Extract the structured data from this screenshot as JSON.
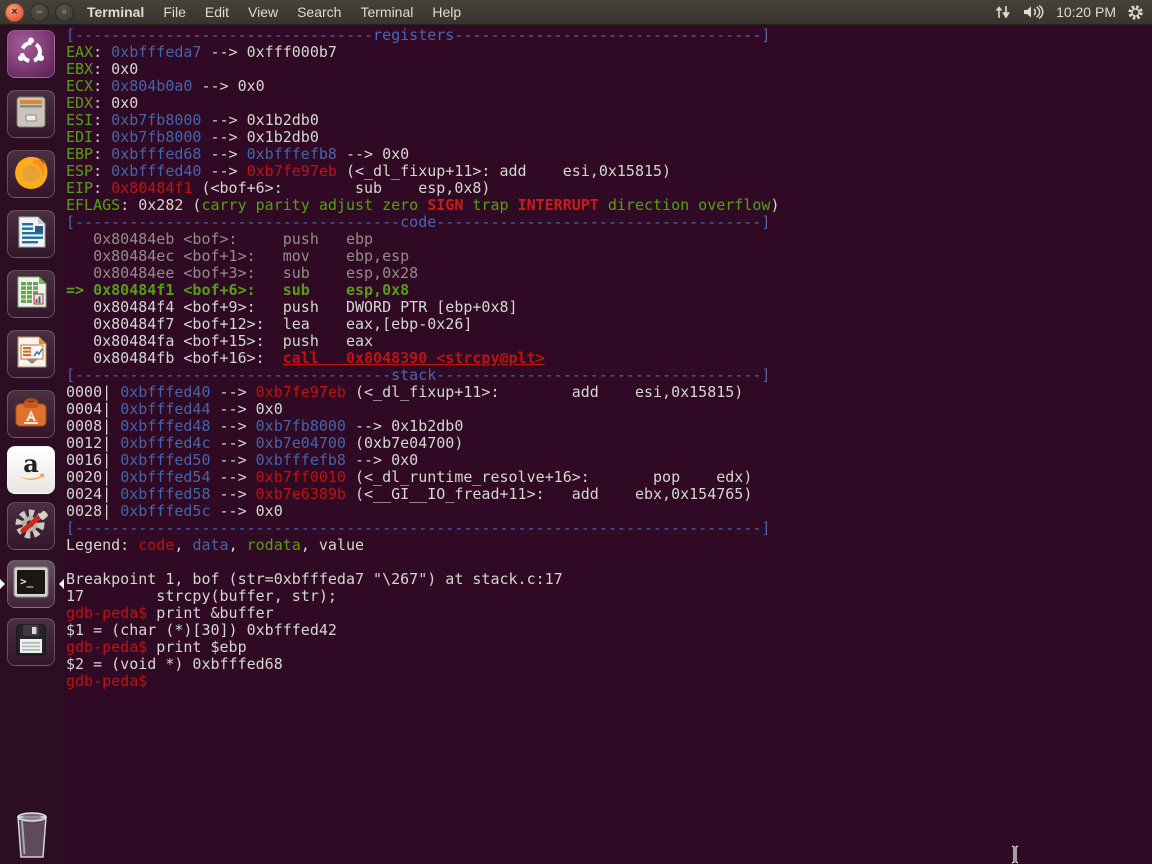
{
  "panel": {
    "window_buttons": {
      "close": "×",
      "minimize": "–",
      "maximize": "▫"
    },
    "app_title": "Terminal",
    "menus": [
      "File",
      "Edit",
      "View",
      "Search",
      "Terminal",
      "Help"
    ],
    "clock": "10:20 PM",
    "indicator_icons": [
      "network-arrows-icon",
      "volume-icon",
      "session-gear-icon"
    ]
  },
  "launcher": {
    "items": [
      {
        "name": "Ubuntu Dash"
      },
      {
        "name": "Files"
      },
      {
        "name": "Firefox Web Browser"
      },
      {
        "name": "LibreOffice Writer"
      },
      {
        "name": "LibreOffice Calc"
      },
      {
        "name": "LibreOffice Impress"
      },
      {
        "name": "Ubuntu Software Center"
      },
      {
        "name": "Amazon"
      },
      {
        "name": "System Settings"
      },
      {
        "name": "Terminal"
      },
      {
        "name": "Disk"
      },
      {
        "name": "Trash"
      }
    ],
    "active_item": "Terminal"
  },
  "terminal": {
    "colors": {
      "background": "#300A24",
      "foreground": "#d3d7cf",
      "data_blue": "#4665a9",
      "code_red": "#c01010",
      "rodata_green": "#55a012",
      "dim_gray": "#928e87"
    },
    "lines": [
      [
        [
          "ban",
          "[---------------------------------registers----------------------------------]"
        ]
      ],
      [
        [
          "g",
          "EAX"
        ],
        [
          "w",
          ": "
        ],
        [
          "b",
          "0xbfffeda7"
        ],
        [
          "w",
          " --> 0xfff000b7"
        ]
      ],
      [
        [
          "g",
          "EBX"
        ],
        [
          "w",
          ": 0x0"
        ]
      ],
      [
        [
          "g",
          "ECX"
        ],
        [
          "w",
          ": "
        ],
        [
          "b",
          "0x804b0a0"
        ],
        [
          "w",
          " --> 0x0"
        ]
      ],
      [
        [
          "g",
          "EDX"
        ],
        [
          "w",
          ": 0x0"
        ]
      ],
      [
        [
          "g",
          "ESI"
        ],
        [
          "w",
          ": "
        ],
        [
          "b",
          "0xb7fb8000"
        ],
        [
          "w",
          " --> 0x1b2db0"
        ]
      ],
      [
        [
          "g",
          "EDI"
        ],
        [
          "w",
          ": "
        ],
        [
          "b",
          "0xb7fb8000"
        ],
        [
          "w",
          " --> 0x1b2db0"
        ]
      ],
      [
        [
          "g",
          "EBP"
        ],
        [
          "w",
          ": "
        ],
        [
          "b",
          "0xbfffed68"
        ],
        [
          "w",
          " --> "
        ],
        [
          "b",
          "0xbfffefb8"
        ],
        [
          "w",
          " --> 0x0"
        ]
      ],
      [
        [
          "g",
          "ESP"
        ],
        [
          "w",
          ": "
        ],
        [
          "b",
          "0xbfffed40"
        ],
        [
          "w",
          " --> "
        ],
        [
          "r",
          "0xb7fe97eb"
        ],
        [
          "w",
          " (<_dl_fixup+11>: add    esi,0x15815)"
        ]
      ],
      [
        [
          "g",
          "EIP"
        ],
        [
          "w",
          ": "
        ],
        [
          "r",
          "0x80484f1"
        ],
        [
          "w",
          " (<bof+6>:        sub    esp,0x8)"
        ]
      ],
      [
        [
          "g",
          "EFLAGS"
        ],
        [
          "w",
          ": 0x282 ("
        ],
        [
          "g",
          "carry parity adjust zero "
        ],
        [
          "rb",
          "SIGN"
        ],
        [
          "g",
          " trap "
        ],
        [
          "rb",
          "INTERRUPT"
        ],
        [
          "g",
          " direction overflow"
        ],
        [
          "w",
          ")"
        ]
      ],
      [
        [
          "ban",
          "[------------------------------------code------------------------------------]"
        ]
      ],
      [
        [
          "gray",
          "   0x80484eb <bof>:     push   ebp"
        ]
      ],
      [
        [
          "gray",
          "   0x80484ec <bof+1>:   mov    ebp,esp"
        ]
      ],
      [
        [
          "gray",
          "   0x80484ee <bof+3>:   sub    esp,0x28"
        ]
      ],
      [
        [
          "gb",
          "=> 0x80484f1 <bof+6>:   sub    esp,0x8"
        ]
      ],
      [
        [
          "w",
          "   0x80484f4 <bof+9>:   push   DWORD PTR [ebp+0x8]"
        ]
      ],
      [
        [
          "w",
          "   0x80484f7 <bof+12>:  lea    eax,[ebp-0x26]"
        ]
      ],
      [
        [
          "w",
          "   0x80484fa <bof+15>:  push   eax"
        ]
      ],
      [
        [
          "w",
          "   0x80484fb <bof+16>:  "
        ],
        [
          "ru",
          "call   0x8048390 <strcpy@plt>"
        ]
      ],
      [
        [
          "ban",
          "[-----------------------------------stack------------------------------------]"
        ]
      ],
      [
        [
          "w",
          "0000| "
        ],
        [
          "b",
          "0xbfffed40"
        ],
        [
          "w",
          " --> "
        ],
        [
          "r",
          "0xb7fe97eb"
        ],
        [
          "w",
          " (<_dl_fixup+11>:        add    esi,0x15815)"
        ]
      ],
      [
        [
          "w",
          "0004| "
        ],
        [
          "b",
          "0xbfffed44"
        ],
        [
          "w",
          " --> 0x0"
        ]
      ],
      [
        [
          "w",
          "0008| "
        ],
        [
          "b",
          "0xbfffed48"
        ],
        [
          "w",
          " --> "
        ],
        [
          "b",
          "0xb7fb8000"
        ],
        [
          "w",
          " --> 0x1b2db0"
        ]
      ],
      [
        [
          "w",
          "0012| "
        ],
        [
          "b",
          "0xbfffed4c"
        ],
        [
          "w",
          " --> "
        ],
        [
          "b",
          "0xb7e04700"
        ],
        [
          "w",
          " (0xb7e04700)"
        ]
      ],
      [
        [
          "w",
          "0016| "
        ],
        [
          "b",
          "0xbfffed50"
        ],
        [
          "w",
          " --> "
        ],
        [
          "b",
          "0xbfffefb8"
        ],
        [
          "w",
          " --> 0x0"
        ]
      ],
      [
        [
          "w",
          "0020| "
        ],
        [
          "b",
          "0xbfffed54"
        ],
        [
          "w",
          " --> "
        ],
        [
          "r",
          "0xb7ff0010"
        ],
        [
          "w",
          " (<_dl_runtime_resolve+16>:       pop    edx)"
        ]
      ],
      [
        [
          "w",
          "0024| "
        ],
        [
          "b",
          "0xbfffed58"
        ],
        [
          "w",
          " --> "
        ],
        [
          "r",
          "0xb7e6389b"
        ],
        [
          "w",
          " (<__GI__IO_fread+11>:   add    ebx,0x154765)"
        ]
      ],
      [
        [
          "w",
          "0028| "
        ],
        [
          "b",
          "0xbfffed5c"
        ],
        [
          "w",
          " --> 0x0"
        ]
      ],
      [
        [
          "ban",
          "[----------------------------------------------------------------------------]"
        ]
      ],
      [
        [
          "w",
          "Legend: "
        ],
        [
          "r",
          "code"
        ],
        [
          "w",
          ", "
        ],
        [
          "b",
          "data"
        ],
        [
          "w",
          ", "
        ],
        [
          "g",
          "rodata"
        ],
        [
          "w",
          ", value"
        ]
      ],
      [],
      [
        [
          "w",
          "Breakpoint 1, bof (str=0xbfffeda7 \"\\267\") at stack.c:17"
        ]
      ],
      [
        [
          "w",
          "17        strcpy(buffer, str);"
        ]
      ],
      [
        [
          "r",
          "gdb-peda$"
        ],
        [
          "w",
          " print &buffer"
        ]
      ],
      [
        [
          "w",
          "$1 = (char (*)[30]) 0xbfffed42"
        ]
      ],
      [
        [
          "r",
          "gdb-peda$"
        ],
        [
          "w",
          " print $ebp"
        ]
      ],
      [
        [
          "w",
          "$2 = (void *) 0xbfffed68"
        ]
      ],
      [
        [
          "r",
          "gdb-peda$"
        ],
        [
          "w",
          " "
        ]
      ]
    ]
  }
}
